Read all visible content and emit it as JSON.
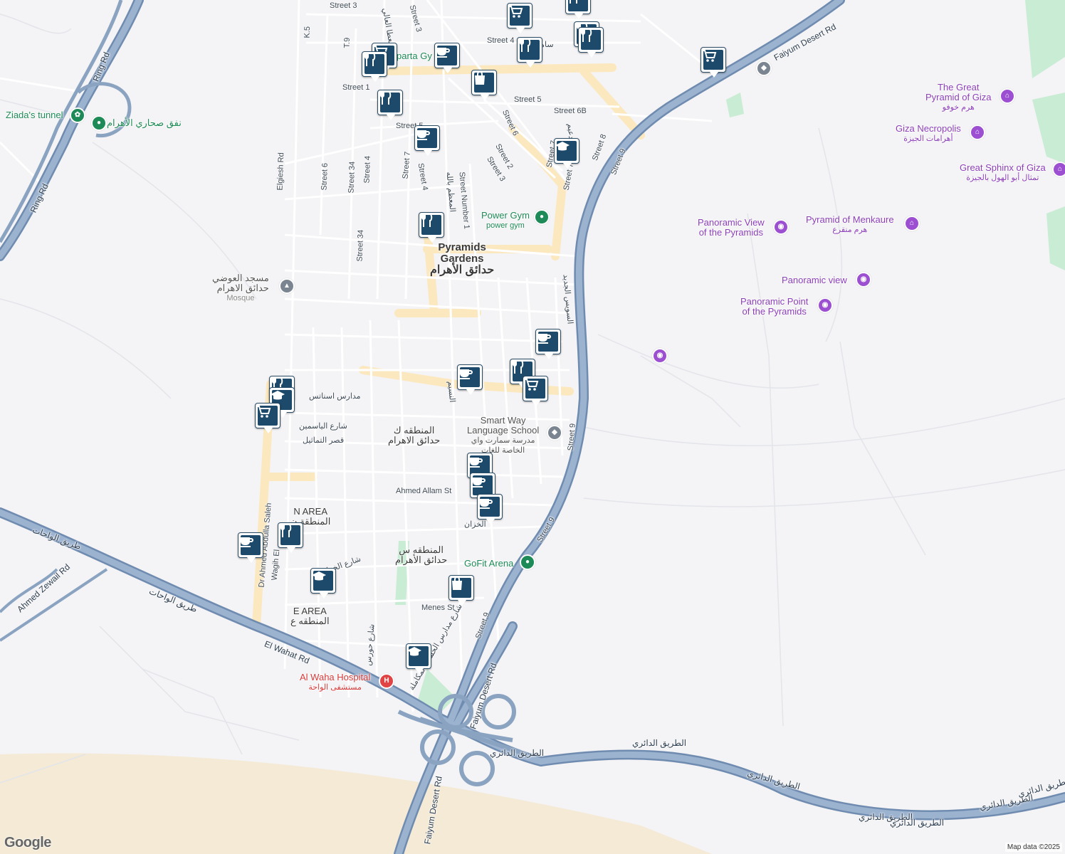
{
  "map": {
    "attribution": "Map data ©2025",
    "logo": "Google",
    "colors": {
      "background": "#f4f3f5",
      "highway": "#8aa3c1",
      "road": "#ffffff",
      "beige_road": "#fbe8bf",
      "park": "#c9ecd4",
      "desert": "#f4ead5",
      "pin": "#1d4a6a",
      "poi_purple": "#8b3fb8",
      "poi_green": "#1e8a57",
      "poi_red": "#d63a3a"
    }
  },
  "areas": [
    {
      "id": "pyramids-gardens",
      "lines": [
        "Pyramids",
        "Gardens"
      ],
      "ar": "حدائق الأهرام"
    }
  ],
  "districts": [
    {
      "id": "district-k",
      "lines": [
        "المنطقه ك",
        "حدائق الاهرام"
      ]
    },
    {
      "id": "district-n",
      "lines": [
        "N AREA",
        "المنطقة ن"
      ]
    },
    {
      "id": "district-s",
      "lines": [
        "المنطقه س",
        "حدائق الأهرام"
      ]
    },
    {
      "id": "district-e",
      "lines": [
        "E AREA",
        "المنطقه ع"
      ]
    }
  ],
  "pois": [
    {
      "id": "great-pyramid",
      "lines": [
        "The Great",
        "Pyramid of Giza",
        "هرم خوفو"
      ],
      "color": "purple",
      "icon": "landmark-icon"
    },
    {
      "id": "giza-necropolis",
      "lines": [
        "Giza Necropolis",
        "أهرامات الجيزة"
      ],
      "color": "purple",
      "icon": "landmark-icon"
    },
    {
      "id": "great-sphinx",
      "lines": [
        "Great Sphinx of Giza",
        "تمثال أبو الهول بالجيزة"
      ],
      "color": "purple",
      "icon": "landmark-icon"
    },
    {
      "id": "pyramid-menkaure",
      "lines": [
        "Pyramid of Menkaure",
        "هرم منقرع"
      ],
      "color": "purple",
      "icon": "landmark-icon"
    },
    {
      "id": "panoramic-view-pyramids",
      "lines": [
        "Panoramic View",
        "of the Pyramids"
      ],
      "color": "purple",
      "icon": "camera-icon"
    },
    {
      "id": "panoramic-view",
      "lines": [
        "Panoramic view"
      ],
      "color": "purple",
      "icon": "camera-icon"
    },
    {
      "id": "panoramic-point",
      "lines": [
        "Panoramic Point",
        "of the Pyramids"
      ],
      "color": "purple",
      "icon": "camera-icon"
    },
    {
      "id": "ziadas-tunnel",
      "lines": [
        "Ziada's tunnel"
      ],
      "color": "green",
      "icon": "flower-icon"
    },
    {
      "id": "desert-tunnel",
      "lines": [
        "نفق صحاري الأهرام"
      ],
      "color": "green",
      "icon": "park-icon"
    },
    {
      "id": "power-gym",
      "lines": [
        "Power Gym",
        "power gym"
      ],
      "color": "green",
      "icon": "gym-icon"
    },
    {
      "id": "sparta-gym",
      "lines": [
        "parta Gy"
      ],
      "color": "green",
      "icon": "gym-icon"
    },
    {
      "id": "gofit-arena",
      "lines": [
        "GoFit Arena"
      ],
      "color": "green",
      "icon": "gym-icon"
    },
    {
      "id": "mosque",
      "lines": [
        "مسجد العوضي",
        "حدائق الاهرام",
        "Mosque"
      ],
      "color": "gray",
      "icon": "mosque-icon"
    },
    {
      "id": "smart-way-school",
      "lines": [
        "Smart Way",
        "Language School",
        "مدرسة سمارت واي",
        "الخاصة للغات"
      ],
      "color": "gray",
      "icon": "school-icon"
    },
    {
      "id": "al-waha-hospital",
      "lines": [
        "Al Waha Hospital",
        "مستشفى الواحة"
      ],
      "color": "red",
      "icon": "hospital-icon"
    }
  ],
  "streets": [
    "Street 3",
    "Street 4",
    "Street 1",
    "Street 5",
    "Street 6B",
    "Street 6",
    "Street 2",
    "Street 3",
    "Street 5",
    "Street 4",
    "Street 7",
    "Street Number 1",
    "Street 6",
    "Street 34",
    "Street 4",
    "Street 7",
    "Street 34",
    "Street 8",
    "Street 7",
    "K.5",
    "T.9",
    "Elgiesh Rd",
    "مدارس اسناتس",
    "شارع الياسمين",
    "قصر التماثيل",
    "Ahmed Allam St",
    "Menes St",
    "Dr Ahmed Abdulla Saleh",
    "Wagih El",
    "شارع الخزان",
    "شارع حورس",
    "شارع مدارس الحسام المكاملة",
    "Street 9",
    "Street 9",
    "Street 9",
    "Street 9",
    "Faiyum Desert Rd",
    "Faiyum Desert Rd",
    "Faiyum Desert Rd",
    "Ring Rd",
    "Ring Rd",
    "Ahmed Zewail Rd",
    "El Wahat Rd",
    "طريق الواحات",
    "طريق الواحات",
    "الطريق الدائري",
    "الطريق الدائري",
    "الطريق الدائري",
    "الطريق الدائري",
    "الطريق الدائري",
    "الطريق الدائري",
    "الطريق الدائري",
    "Street 3",
    "المعظم بالله",
    "المعطا العالي",
    "سامي",
    "الخزان",
    "السويس الجديد",
    "الدعيم",
    "النسيم"
  ],
  "markers": [
    {
      "id": "m1",
      "type": "cart"
    },
    {
      "id": "m2",
      "type": "fork"
    },
    {
      "id": "m3",
      "type": "fork"
    },
    {
      "id": "m4",
      "type": "fork"
    },
    {
      "id": "m5",
      "type": "cart"
    },
    {
      "id": "m6",
      "type": "cup"
    },
    {
      "id": "m7",
      "type": "fork"
    },
    {
      "id": "m8",
      "type": "fork"
    },
    {
      "id": "m9",
      "type": "bag"
    },
    {
      "id": "m10",
      "type": "fork"
    },
    {
      "id": "m11",
      "type": "cup"
    },
    {
      "id": "m12",
      "type": "cap"
    },
    {
      "id": "m13",
      "type": "fork"
    },
    {
      "id": "m14",
      "type": "cart"
    },
    {
      "id": "m15",
      "type": "cup"
    },
    {
      "id": "m16",
      "type": "fork"
    },
    {
      "id": "m17",
      "type": "cup"
    },
    {
      "id": "m18",
      "type": "cart"
    },
    {
      "id": "m19",
      "type": "fork"
    },
    {
      "id": "m20",
      "type": "cap"
    },
    {
      "id": "m21",
      "type": "cart"
    },
    {
      "id": "m22",
      "type": "cup"
    },
    {
      "id": "m23",
      "type": "cup"
    },
    {
      "id": "m24",
      "type": "cup"
    },
    {
      "id": "m25",
      "type": "cup"
    },
    {
      "id": "m26",
      "type": "fork"
    },
    {
      "id": "m27",
      "type": "cap"
    },
    {
      "id": "m28",
      "type": "bag"
    },
    {
      "id": "m29",
      "type": "cap"
    }
  ]
}
